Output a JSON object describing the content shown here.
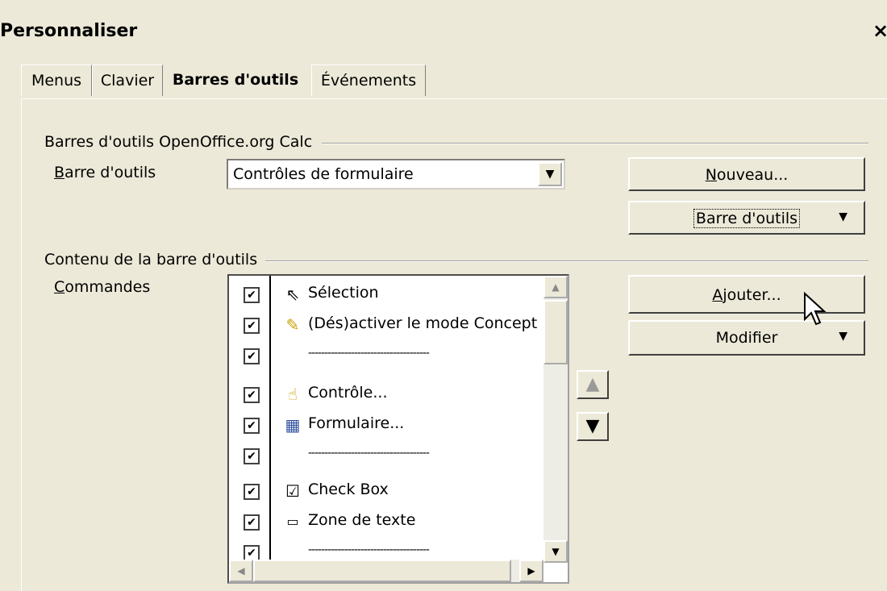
{
  "window": {
    "title": "Personnaliser",
    "close_glyph": "×"
  },
  "tabs": [
    {
      "label": "Menus"
    },
    {
      "label": "Clavier"
    },
    {
      "label": "Barres d'outils",
      "active": true
    },
    {
      "label": "Événements"
    }
  ],
  "toolbars_group": {
    "title": "Barres d'outils OpenOffice.org Calc",
    "field_label": "Barre d'outils",
    "field_label_mnemonic": "B",
    "selected_toolbar": "Contrôles de formulaire",
    "new_button": "Nouveau...",
    "new_button_mnemonic": "N",
    "toolbar_menu_button": "Barre d'outils"
  },
  "content_group": {
    "title": "Contenu de la barre d'outils",
    "commands_label": "Commandes",
    "commands_label_mnemonic": "C",
    "commands": [
      {
        "checked": true,
        "icon": "selection-arrow-icon",
        "glyph": "⇖",
        "label": "Sélection"
      },
      {
        "checked": true,
        "icon": "design-mode-icon",
        "glyph": "✎",
        "label": "(Dés)activer le mode Concept"
      },
      {
        "checked": true,
        "separator": true,
        "label": "-------------------------------------"
      },
      {
        "checked": true,
        "icon": "control-icon",
        "glyph": "☝",
        "label": "Contrôle..."
      },
      {
        "checked": true,
        "icon": "form-icon",
        "glyph": "▦",
        "label": "Formulaire..."
      },
      {
        "checked": true,
        "separator": true,
        "label": "-------------------------------------"
      },
      {
        "checked": true,
        "icon": "checkbox-control-icon",
        "glyph": "☑",
        "label": "Check Box"
      },
      {
        "checked": true,
        "icon": "text-box-icon",
        "glyph": "▭",
        "label": "Zone de texte"
      },
      {
        "checked": true,
        "separator": true,
        "label": "-------------------------------------"
      }
    ],
    "add_button": "Ajouter...",
    "add_button_mnemonic": "A",
    "modify_button": "Modifier"
  },
  "glyphs": {
    "check": "✔",
    "dropdown": "▼",
    "up": "▲",
    "down": "▼",
    "left": "◀",
    "right": "▶",
    "move_up": "🡅",
    "move_down": "🡇"
  }
}
